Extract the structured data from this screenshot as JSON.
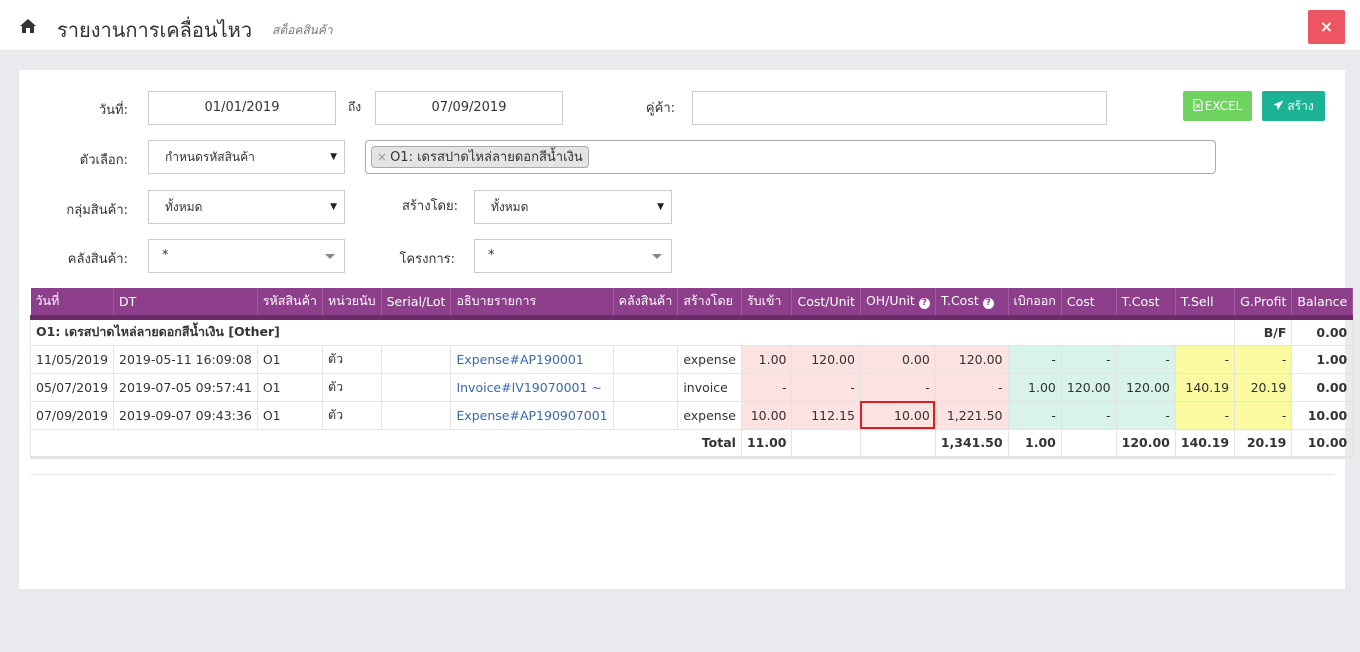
{
  "header": {
    "title": "รายงานการเคลื่อนไหว",
    "subtitle": "สต็อคสินค้า",
    "close_label": "×"
  },
  "filters": {
    "date_label": "วันที่:",
    "date_from": "01/01/2019",
    "to_label": "ถึง",
    "date_to": "07/09/2019",
    "partner_label": "คู่ค้า:",
    "partner_value": "",
    "option_label": "ตัวเลือก:",
    "option_value": "กำหนดรหัสสินค้า",
    "product_tag": "O1: เดรสปาดไหล่ลายดอกสีน้ำเงิน",
    "tag_remove": "×",
    "group_label": "กลุ่มสินค้า:",
    "group_value": "ทั้งหมด",
    "created_by_label": "สร้างโดย:",
    "created_by_value": "ทั้งหมด",
    "warehouse_label": "คลังสินค้า:",
    "warehouse_value": "*",
    "project_label": "โครงการ:",
    "project_value": "*"
  },
  "buttons": {
    "excel": "EXCEL",
    "create": "สร้าง"
  },
  "table": {
    "columns": [
      "วันที่",
      "DT",
      "รหัสสินค้า",
      "หน่วยนับ",
      "Serial/Lot",
      "อธิบายรายการ",
      "คลังสินค้า",
      "สร้างโดย",
      "รับเข้า",
      "Cost/Unit",
      "OH/Unit",
      "T.Cost",
      "เบิกออก",
      "Cost",
      "T.Cost",
      "T.Sell",
      "G.Profit",
      "Balance"
    ],
    "group_row": {
      "label": "O1: เดรสปาดไหล่ลายดอกสีน้ำเงิน [Other]",
      "bf": "B/F",
      "balance": "0.00"
    },
    "rows": [
      {
        "date": "11/05/2019",
        "dt": "2019-05-11 16:09:08",
        "code": "O1",
        "unit": "ตัว",
        "serial": "",
        "desc": "Expense#AP190001",
        "wh": "",
        "by": "expense",
        "in": "1.00",
        "cost_unit": "120.00",
        "oh_unit": "0.00",
        "t_cost": "120.00",
        "out": "-",
        "cost": "-",
        "t_cost2": "-",
        "t_sell": "-",
        "g_profit": "-",
        "balance": "1.00"
      },
      {
        "date": "05/07/2019",
        "dt": "2019-07-05 09:57:41",
        "code": "O1",
        "unit": "ตัว",
        "serial": "",
        "desc": "Invoice#IV19070001 ~",
        "wh": "",
        "by": "invoice",
        "in": "-",
        "cost_unit": "-",
        "oh_unit": "-",
        "t_cost": "-",
        "out": "1.00",
        "cost": "120.00",
        "t_cost2": "120.00",
        "t_sell": "140.19",
        "g_profit": "20.19",
        "balance": "0.00"
      },
      {
        "date": "07/09/2019",
        "dt": "2019-09-07 09:43:36",
        "code": "O1",
        "unit": "ตัว",
        "serial": "",
        "desc": "Expense#AP190907001",
        "wh": "",
        "by": "expense",
        "in": "10.00",
        "cost_unit": "112.15",
        "oh_unit": "10.00",
        "t_cost": "1,221.50",
        "out": "-",
        "cost": "-",
        "t_cost2": "-",
        "t_sell": "-",
        "g_profit": "-",
        "balance": "10.00"
      }
    ],
    "total": {
      "label": "Total",
      "in": "11.00",
      "t_cost": "1,341.50",
      "out": "1.00",
      "t_cost2": "120.00",
      "t_sell": "140.19",
      "g_profit": "20.19",
      "balance": "10.00"
    }
  },
  "colors": {
    "header_bg": "#8e3f8c",
    "excel_btn": "#6fd35f",
    "create_btn": "#1ab394",
    "close_btn": "#ed5565",
    "highlight": "#e21b23"
  }
}
